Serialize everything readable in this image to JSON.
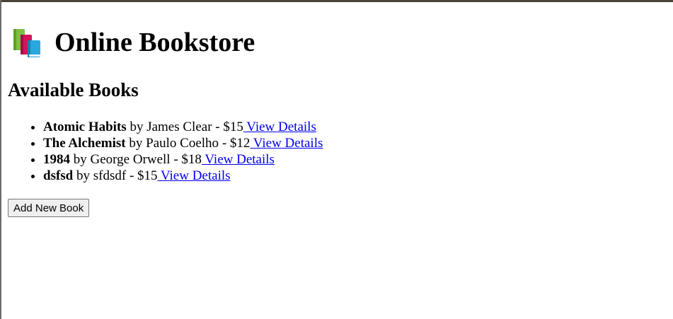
{
  "header": {
    "title": "Online Bookstore",
    "icon": "books-icon"
  },
  "section": {
    "title": "Available Books"
  },
  "books": [
    {
      "title": "Atomic Habits",
      "author": "James Clear",
      "price": "$15",
      "link_label": " View Details"
    },
    {
      "title": "The Alchemist",
      "author": "Paulo Coelho",
      "price": "$12",
      "link_label": " View Details"
    },
    {
      "title": "1984",
      "author": "George Orwell",
      "price": "$18",
      "link_label": " View Details"
    },
    {
      "title": "dsfsd",
      "author": "sfdsdf",
      "price": "$15",
      "link_label": " View Details"
    }
  ],
  "actions": {
    "add_book_label": "Add New Book"
  },
  "colors": {
    "link": "#0000ee",
    "button_bg": "#efefef"
  }
}
